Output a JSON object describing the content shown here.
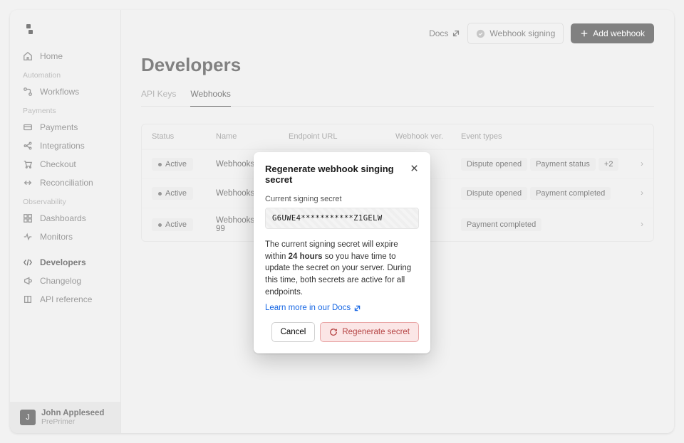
{
  "sidebar": {
    "home": "Home",
    "sections": [
      {
        "header": "Automation",
        "items": [
          "Workflows"
        ]
      },
      {
        "header": "Payments",
        "items": [
          "Payments",
          "Integrations",
          "Checkout",
          "Reconciliation"
        ]
      },
      {
        "header": "Observability",
        "items": [
          "Dashboards",
          "Monitors"
        ]
      }
    ],
    "dev_items": [
      "Developers",
      "Changelog",
      "API reference"
    ],
    "user": {
      "initial": "J",
      "name": "John Appleseed",
      "org": "PrePrimer"
    }
  },
  "topbar": {
    "docs": "Docs",
    "webhook_signing": "Webhook signing",
    "add_webhook": "Add webhook"
  },
  "page_title": "Developers",
  "tabs": [
    "API Keys",
    "Webhooks"
  ],
  "table": {
    "headers": {
      "status": "Status",
      "name": "Name",
      "url": "Endpoint URL",
      "ver": "Webhook ver.",
      "types": "Event types"
    },
    "rows": [
      {
        "status": "Active",
        "name": "Webhooks Test 1",
        "types": [
          "Dispute opened",
          "Payment status"
        ],
        "extra": "+2"
      },
      {
        "status": "Active",
        "name": "Webhooks Test 2",
        "types": [
          "Dispute opened",
          "Payment completed"
        ]
      },
      {
        "status": "Active",
        "name": "Webhooks Test 99",
        "types": [
          "Payment completed"
        ]
      }
    ]
  },
  "modal": {
    "title": "Regenerate webhook singing secret",
    "field_label": "Current signing secret",
    "secret": "G6UWE4***********Z1GELW",
    "body_pre": "The current signing secret will expire within ",
    "body_bold": "24 hours",
    "body_post": " so you have time to update the secret on your server. During this time, both secrets are active for all endpoints.",
    "docs_link": "Learn more in our Docs",
    "cancel": "Cancel",
    "regenerate": "Regenerate secret"
  }
}
